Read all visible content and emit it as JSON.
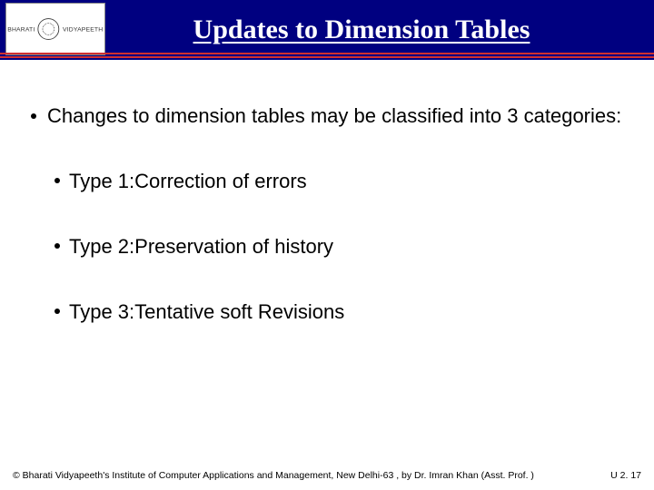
{
  "header": {
    "title": "Updates to Dimension Tables",
    "logo_left": "BHARATI",
    "logo_right": "VIDYAPEETH"
  },
  "body": {
    "intro": "Changes to dimension tables may be classified into 3 categories:",
    "items": [
      "Type 1:Correction of errors",
      "Type 2:Preservation of history",
      "Type 3:Tentative soft Revisions"
    ]
  },
  "footer": {
    "copyright": "© Bharati Vidyapeeth's Institute of Computer Applications and Management, New Delhi-63 , by Dr. Imran Khan (Asst. Prof. )",
    "page": "U 2. 17"
  }
}
